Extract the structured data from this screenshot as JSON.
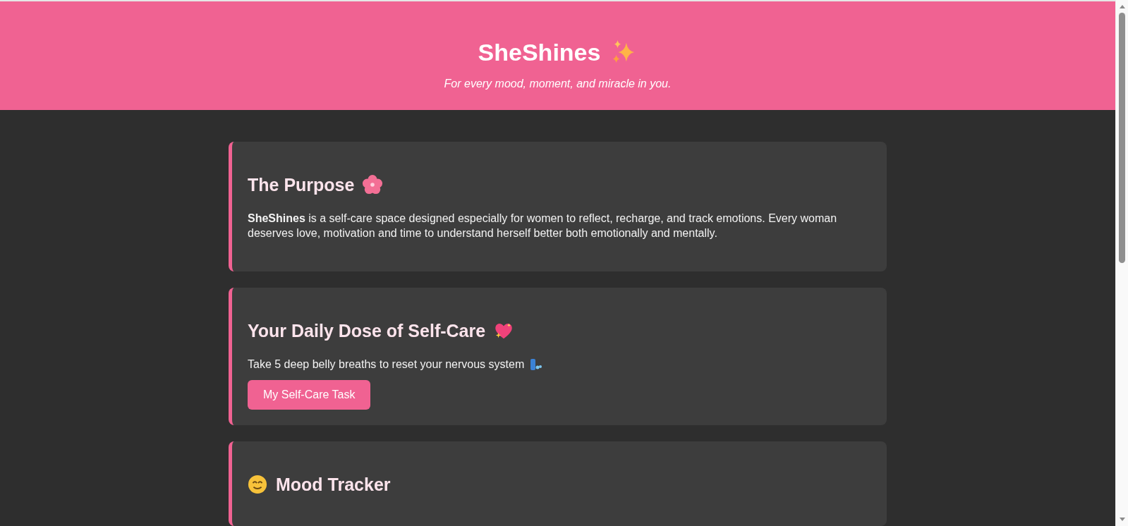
{
  "header": {
    "title": "SheShines",
    "subtitle": "For every mood, moment, and miracle in you."
  },
  "sections": [
    {
      "kind": "purpose",
      "title": "The Purpose",
      "text": "**SheShines** is a self-care space designed especially for women to reflect, recharge, and track emotions. Every woman deserves love, motivation and time to understand herself better both emotionally and mentally."
    },
    {
      "kind": "self_care",
      "title": "Your Daily Dose of Self-Care",
      "text": "Take 5 deep belly breaths to reset your nervous system",
      "button": "My Self-Care Task"
    },
    {
      "kind": "mood",
      "title": "Mood Tracker"
    }
  ]
}
